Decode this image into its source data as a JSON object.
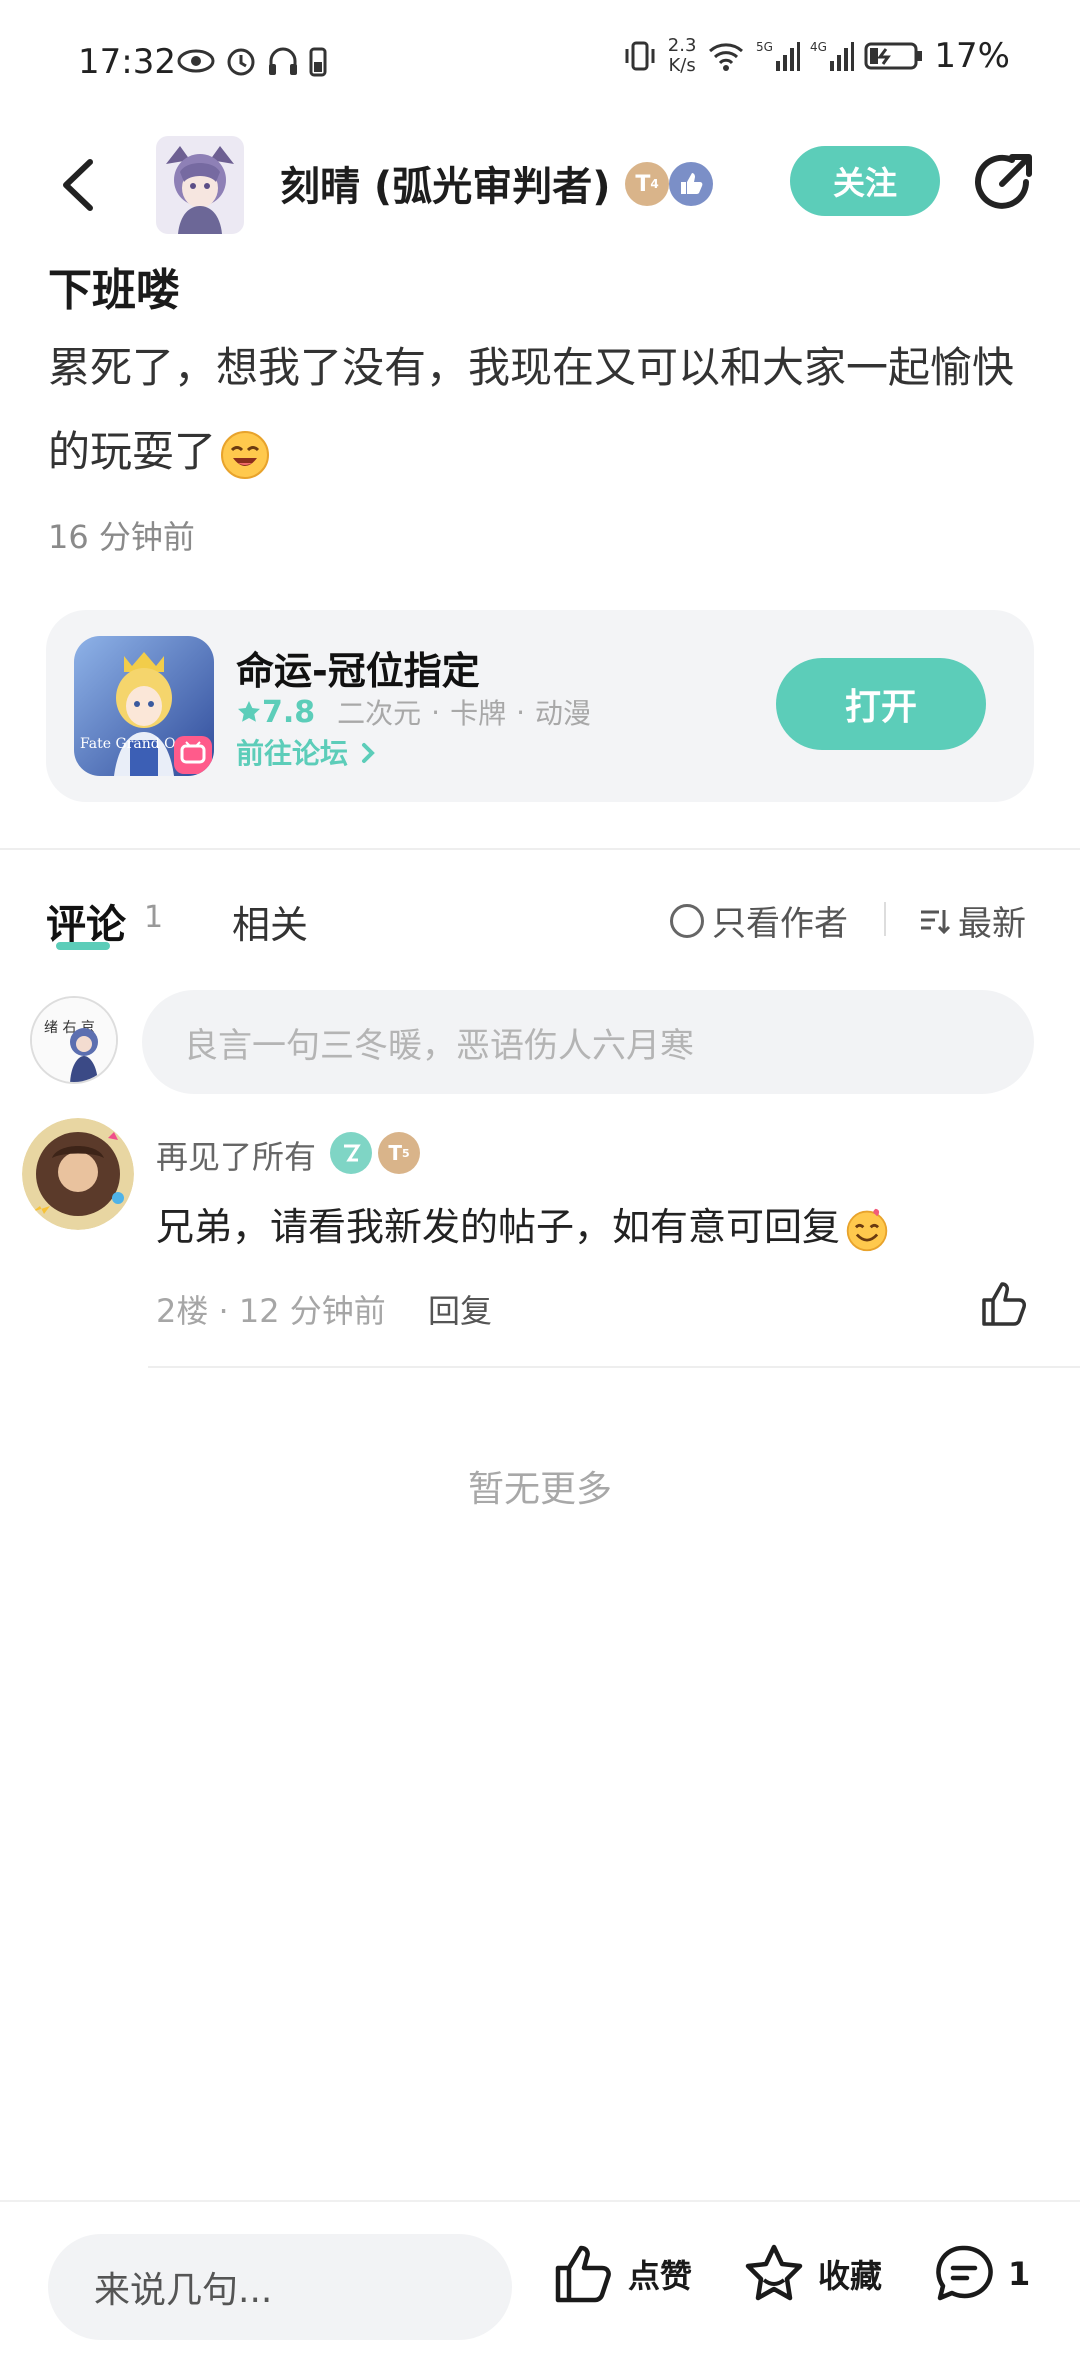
{
  "status_bar": {
    "time": "17:32",
    "net_speed_value": "2.3",
    "net_speed_unit": "K/s",
    "battery": "17%",
    "signal_labels": [
      "5G",
      "4G"
    ]
  },
  "header": {
    "author_name": "刻晴 (弧光审判者)",
    "badge_level": "T",
    "badge_sub": "4",
    "follow_label": "关注"
  },
  "post": {
    "title": "下班喽",
    "body": "累死了，想我了没有，我现在又可以和大家一起愉快的玩耍了",
    "time": "16 分钟前"
  },
  "game_card": {
    "icon_text": "Fate Grand Order",
    "name": "命运-冠位指定",
    "rating": "7.8",
    "tags": [
      "二次元",
      "卡牌",
      "动漫"
    ],
    "forum_link": "前往论坛",
    "open_label": "打开"
  },
  "tabs": {
    "comment_label": "评论",
    "comment_count": "1",
    "related_label": "相关",
    "author_only_label": "只看作者",
    "sort_label": "最新"
  },
  "comment_input": {
    "placeholder": "良言一句三冬暖，恶语伤人六月寒",
    "my_avatar_text": "绪 右 京"
  },
  "comments": [
    {
      "user": "再见了所有",
      "badge_level": "T",
      "badge_sub": "5",
      "text": "兄弟，请看我新发的帖子，如有意可回复",
      "meta": "2楼 · 12 分钟前",
      "reply_label": "回复"
    }
  ],
  "no_more": "暂无更多",
  "bottom_bar": {
    "input_placeholder": "来说几句...",
    "like_label": "点赞",
    "favorite_label": "收藏",
    "comment_count": "1"
  },
  "colors": {
    "accent": "#5ccdb9",
    "gold_badge": "#d9b48a",
    "blue_badge": "#7b8fc7"
  }
}
